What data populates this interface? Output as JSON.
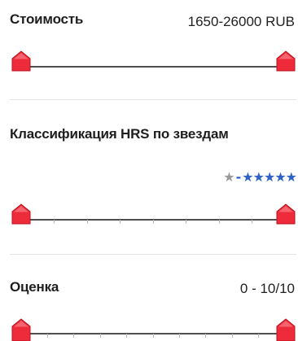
{
  "price_filter": {
    "title": "Стоимость",
    "range_text": "1650-26000 RUB",
    "min_value": 1650,
    "max_value": 26000
  },
  "stars_filter": {
    "title": "Классификация HRS по звездам",
    "min_star_glyph": "★",
    "dash": "-",
    "max_stars_glyph": "★★★★★",
    "min_stars": 1,
    "max_stars": 5
  },
  "rating_filter": {
    "title": "Оценка",
    "range_text": "0 - 10/10",
    "min_value": 0,
    "max_value": 10
  },
  "colors": {
    "handle_red": "#ee2b3a",
    "handle_dark": "#b8101c",
    "track": "#4f4f4f",
    "star_blue": "#2f61c4",
    "star_grey": "#9a9a9a"
  }
}
